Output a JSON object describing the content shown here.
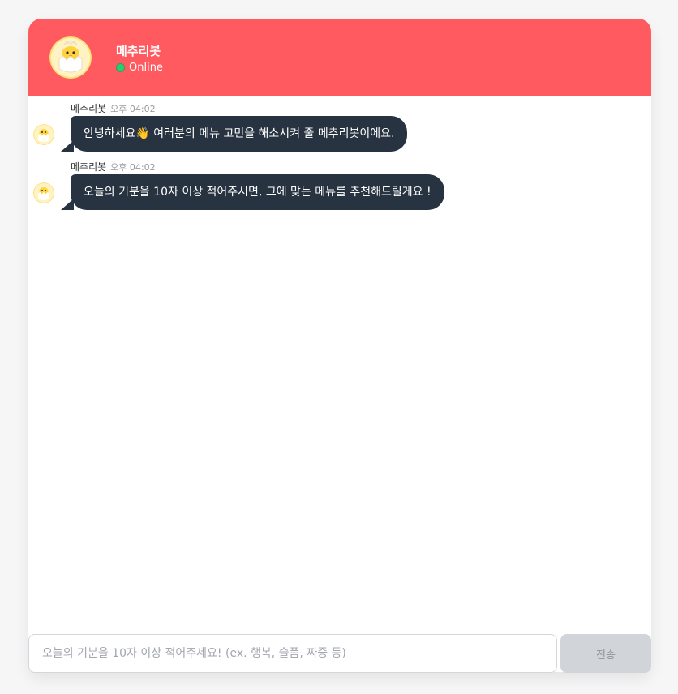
{
  "header": {
    "bot_name": "메추리봇",
    "status": "Online"
  },
  "messages": [
    {
      "sender": "메추리봇",
      "time": "오후 04:02",
      "text": "안녕하세요👋 여러분의 메뉴 고민을 해소시켜 줄 메추리봇이에요."
    },
    {
      "sender": "메추리봇",
      "time": "오후 04:02",
      "text": "오늘의 기분을 10자 이상 적어주시면, 그에 맞는 메뉴를 추천해드릴게요 !"
    }
  ],
  "composer": {
    "placeholder": "오늘의 기분을 10자 이상 적어주세요! (ex. 행복, 슬픔, 짜증 등)",
    "send_label": "전송"
  },
  "colors": {
    "header": "#ff5a5f",
    "bubble": "#283341",
    "online": "#2ecc71",
    "send_disabled": "#d1d4d9"
  },
  "icons": {
    "avatar": "hatching-chick-icon",
    "status": "online-dot-icon"
  }
}
